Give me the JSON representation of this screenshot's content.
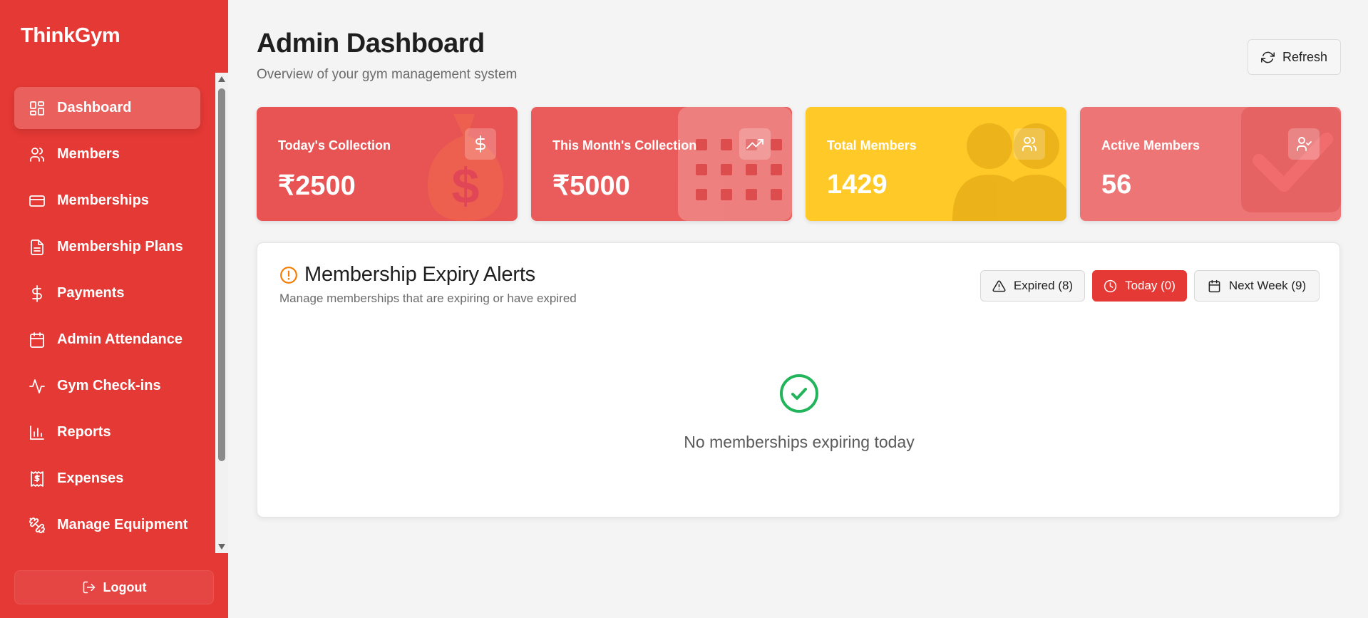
{
  "sidebar": {
    "brand": "ThinkGym",
    "items": [
      {
        "label": "Dashboard",
        "icon": "dashboard-icon",
        "active": true
      },
      {
        "label": "Members",
        "icon": "users-icon"
      },
      {
        "label": "Memberships",
        "icon": "credit-card-icon"
      },
      {
        "label": "Membership Plans",
        "icon": "file-text-icon"
      },
      {
        "label": "Payments",
        "icon": "dollar-icon"
      },
      {
        "label": "Admin Attendance",
        "icon": "calendar-icon"
      },
      {
        "label": "Gym Check-ins",
        "icon": "activity-icon"
      },
      {
        "label": "Reports",
        "icon": "bar-chart-icon"
      },
      {
        "label": "Expenses",
        "icon": "receipt-icon"
      },
      {
        "label": "Manage Equipment",
        "icon": "dumbbell-icon"
      }
    ],
    "logout_label": "Logout"
  },
  "header": {
    "title": "Admin Dashboard",
    "subtitle": "Overview of your gym management system",
    "refresh_label": "Refresh"
  },
  "stats": [
    {
      "label": "Today's Collection",
      "value": "₹2500",
      "icon": "dollar-icon",
      "color": "#e85454"
    },
    {
      "label": "This Month's Collection",
      "value": "₹5000",
      "icon": "trending-up-icon",
      "color": "#ea5c5c"
    },
    {
      "label": "Total Members",
      "value": "1429",
      "icon": "users-icon",
      "color": "#ffc928"
    },
    {
      "label": "Active Members",
      "value": "56",
      "icon": "user-check-icon",
      "color": "#ee7575"
    }
  ],
  "alerts": {
    "title": "Membership Expiry Alerts",
    "subtitle": "Manage memberships that are expiring or have expired",
    "filters": [
      {
        "label": "Expired (8)",
        "icon": "alert-triangle-icon"
      },
      {
        "label": "Today (0)",
        "icon": "clock-icon",
        "active": true
      },
      {
        "label": "Next Week (9)",
        "icon": "calendar-icon"
      }
    ],
    "empty_message": "No memberships expiring today"
  },
  "colors": {
    "sidebar": "#e53935",
    "accent_warning": "#f57c00",
    "success": "#22b45a"
  }
}
